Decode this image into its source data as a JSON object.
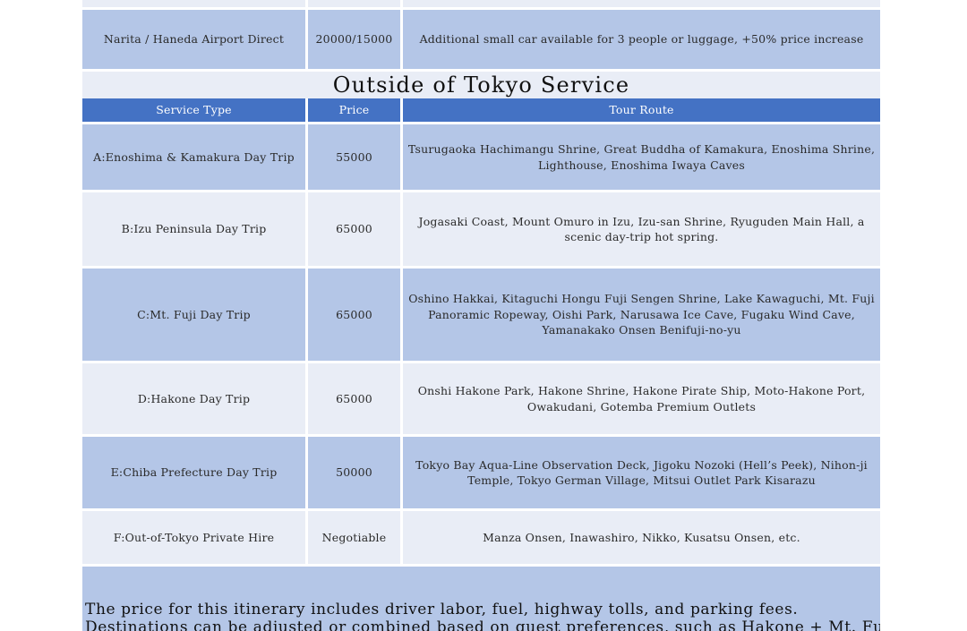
{
  "airport": {
    "service": "Narita / Haneda Airport Direct",
    "price": "20000/15000",
    "note": "Additional small car available for 3 people or luggage, +50% price increase"
  },
  "section_title": "Outside of Tokyo Service",
  "headers": {
    "service_type": "Service Type",
    "price": "Price",
    "tour_route": "Tour Route"
  },
  "tours": [
    {
      "service": "A:Enoshima & Kamakura Day Trip",
      "price": "55000",
      "route": "Tsurugaoka Hachimangu Shrine, Great Buddha of Kamakura, Enoshima Shrine, Lighthouse, Enoshima Iwaya Caves"
    },
    {
      "service": "B:Izu Peninsula Day Trip",
      "price": "65000",
      "route": "Jogasaki Coast, Mount Omuro in Izu, Izu-san Shrine, Ryuguden Main Hall, a scenic day-trip hot spring."
    },
    {
      "service": "C:Mt. Fuji Day Trip",
      "price": "65000",
      "route": "Oshino Hakkai, Kitaguchi Hongu Fuji Sengen Shrine, Lake Kawaguchi, Mt. Fuji Panoramic Ropeway, Oishi Park, Narusawa Ice Cave, Fugaku Wind Cave, Yamanakako Onsen Benifuji-no-yu"
    },
    {
      "service": "D:Hakone Day Trip",
      "price": "65000",
      "route": "Onshi Hakone Park, Hakone Shrine, Hakone Pirate Ship, Moto-Hakone Port, Owakudani, Gotemba Premium Outlets"
    },
    {
      "service": "E:Chiba Prefecture Day Trip",
      "price": "50000",
      "route": "Tokyo Bay Aqua-Line Observation Deck, Jigoku Nozoki (Hell’s Peek), Nihon-ji Temple, Tokyo German Village, Mitsui Outlet Park Kisarazu"
    },
    {
      "service": "F:Out-of-Tokyo Private Hire",
      "price": "Negotiable",
      "route": "Manza Onsen, Inawashiro, Nikko, Kusatsu Onsen, etc."
    }
  ],
  "footer_note": {
    "line1": "The price for this itinerary includes driver labor, fuel, highway tolls, and parking fees.",
    "line2": "Destinations can be adjusted or combined based on guest preferences, such as Hakone + Mt. Fuji or"
  }
}
